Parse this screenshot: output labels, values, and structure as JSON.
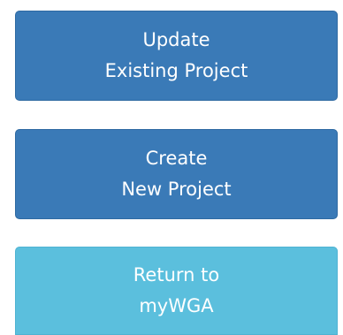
{
  "buttons": {
    "update_project": {
      "line1": "Update",
      "line2": "Existing Project"
    },
    "create_project": {
      "line1": "Create",
      "line2": "New Project"
    },
    "return_mywga": {
      "line1": "Return to",
      "line2": "myWGA"
    }
  },
  "colors": {
    "primary": "#3a7ab7",
    "info": "#5bbfdd",
    "text": "#ffffff"
  }
}
